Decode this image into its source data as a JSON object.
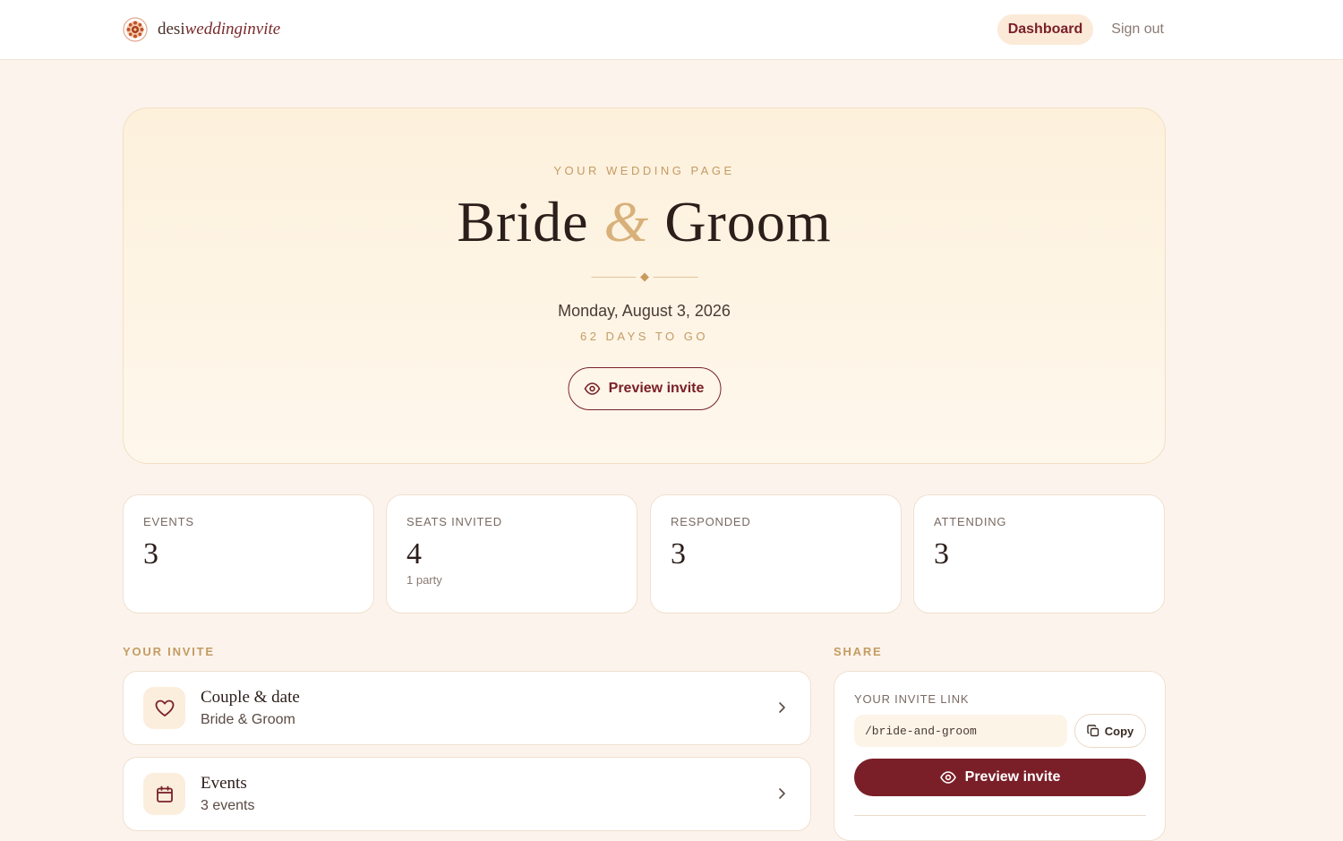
{
  "header": {
    "brand_plain": "desi",
    "brand_italic": "weddinginvite",
    "nav": {
      "dashboard": "Dashboard",
      "sign_out": "Sign out"
    }
  },
  "hero": {
    "eyebrow": "YOUR WEDDING PAGE",
    "bride": "Bride",
    "ampersand": "&",
    "groom": "Groom",
    "date": "Monday, August 3, 2026",
    "countdown": "62 DAYS TO GO",
    "preview_label": "Preview invite"
  },
  "stats": [
    {
      "label": "EVENTS",
      "value": "3",
      "sub": ""
    },
    {
      "label": "SEATS INVITED",
      "value": "4",
      "sub": "1 party"
    },
    {
      "label": "RESPONDED",
      "value": "3",
      "sub": ""
    },
    {
      "label": "ATTENDING",
      "value": "3",
      "sub": ""
    }
  ],
  "invite": {
    "section_label": "YOUR INVITE",
    "items": [
      {
        "title": "Couple & date",
        "sub": "Bride & Groom",
        "icon": "heart-icon"
      },
      {
        "title": "Events",
        "sub": "3 events",
        "icon": "calendar-icon"
      }
    ]
  },
  "share": {
    "section_label": "SHARE",
    "link_label": "YOUR INVITE LINK",
    "link_value": "/bride-and-groom",
    "copy_label": "Copy",
    "preview_label": "Preview invite"
  },
  "colors": {
    "accent": "#7a1f28",
    "gold": "#c49b63",
    "background": "#fcf4ec"
  }
}
